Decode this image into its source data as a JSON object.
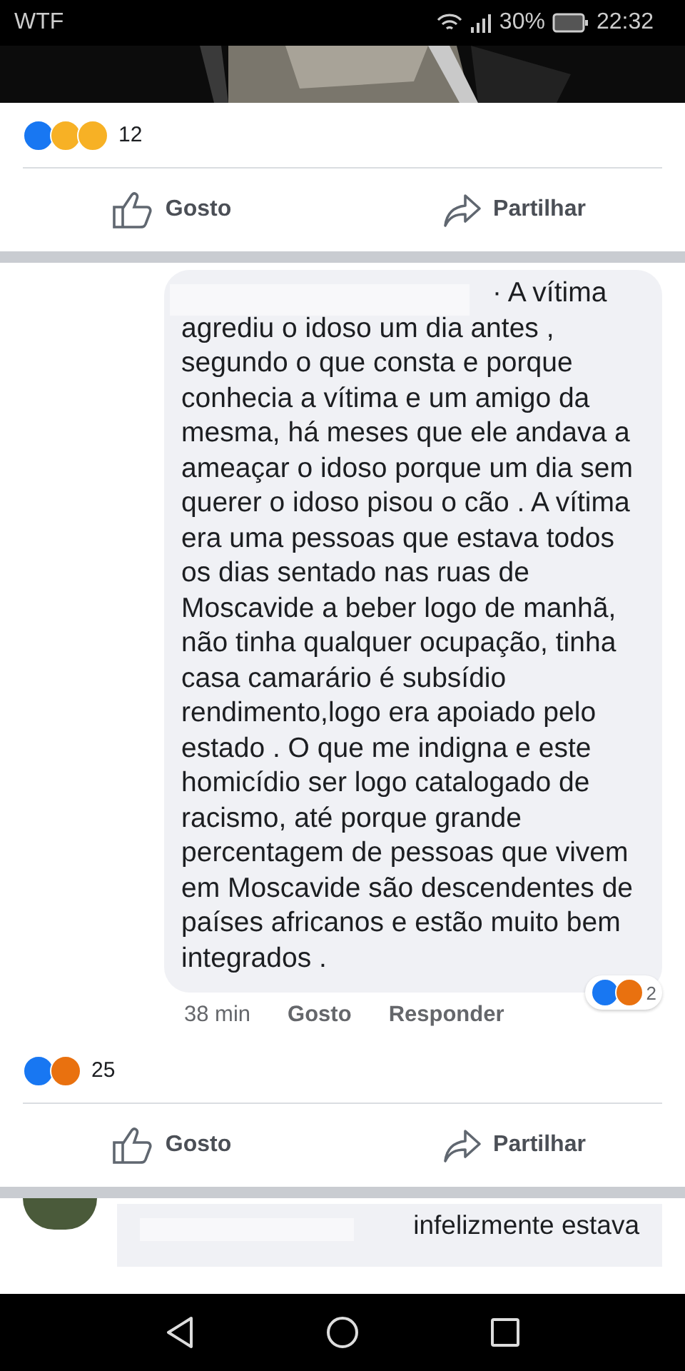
{
  "status_bar": {
    "app_label": "WTF",
    "battery": "30%",
    "time": "22:32"
  },
  "post": {
    "kind": "picture",
    "reactions": {
      "count": "12"
    },
    "actions": [
      "Gosto",
      "Partilhar"
    ]
  },
  "comment": {
    "text": "· A vítima agrediu o idoso um dia antes , segundo o que consta e porque conhecia a vítima e um amigo da mesma, há meses que ele andava a ameaçar o idoso porque um dia sem querer o idoso pisou o cão . A vítima era uma pessoas que estava todos os dias sentado nas ruas de Moscavide a beber logo de manhã, não tinha qualquer ocupação, tinha casa camarário é subsídio rendimento,logo era apoiado pelo estado . O que me indigna e este homicídio ser logo catalogado de racismo, até porque grande percentagem de pessoas que vivem em Moscavide são descendentes de países africanos e estão muito bem integrados .",
    "time": "38 min",
    "like": "Gosto",
    "reply": "Responder",
    "reactions": {
      "count": "2"
    }
  },
  "post2": {
    "reactions": {
      "count": "25"
    },
    "actions": [
      "Gosto",
      "Partilhar"
    ]
  },
  "next_comment": {
    "text": "infelizmente estava"
  }
}
